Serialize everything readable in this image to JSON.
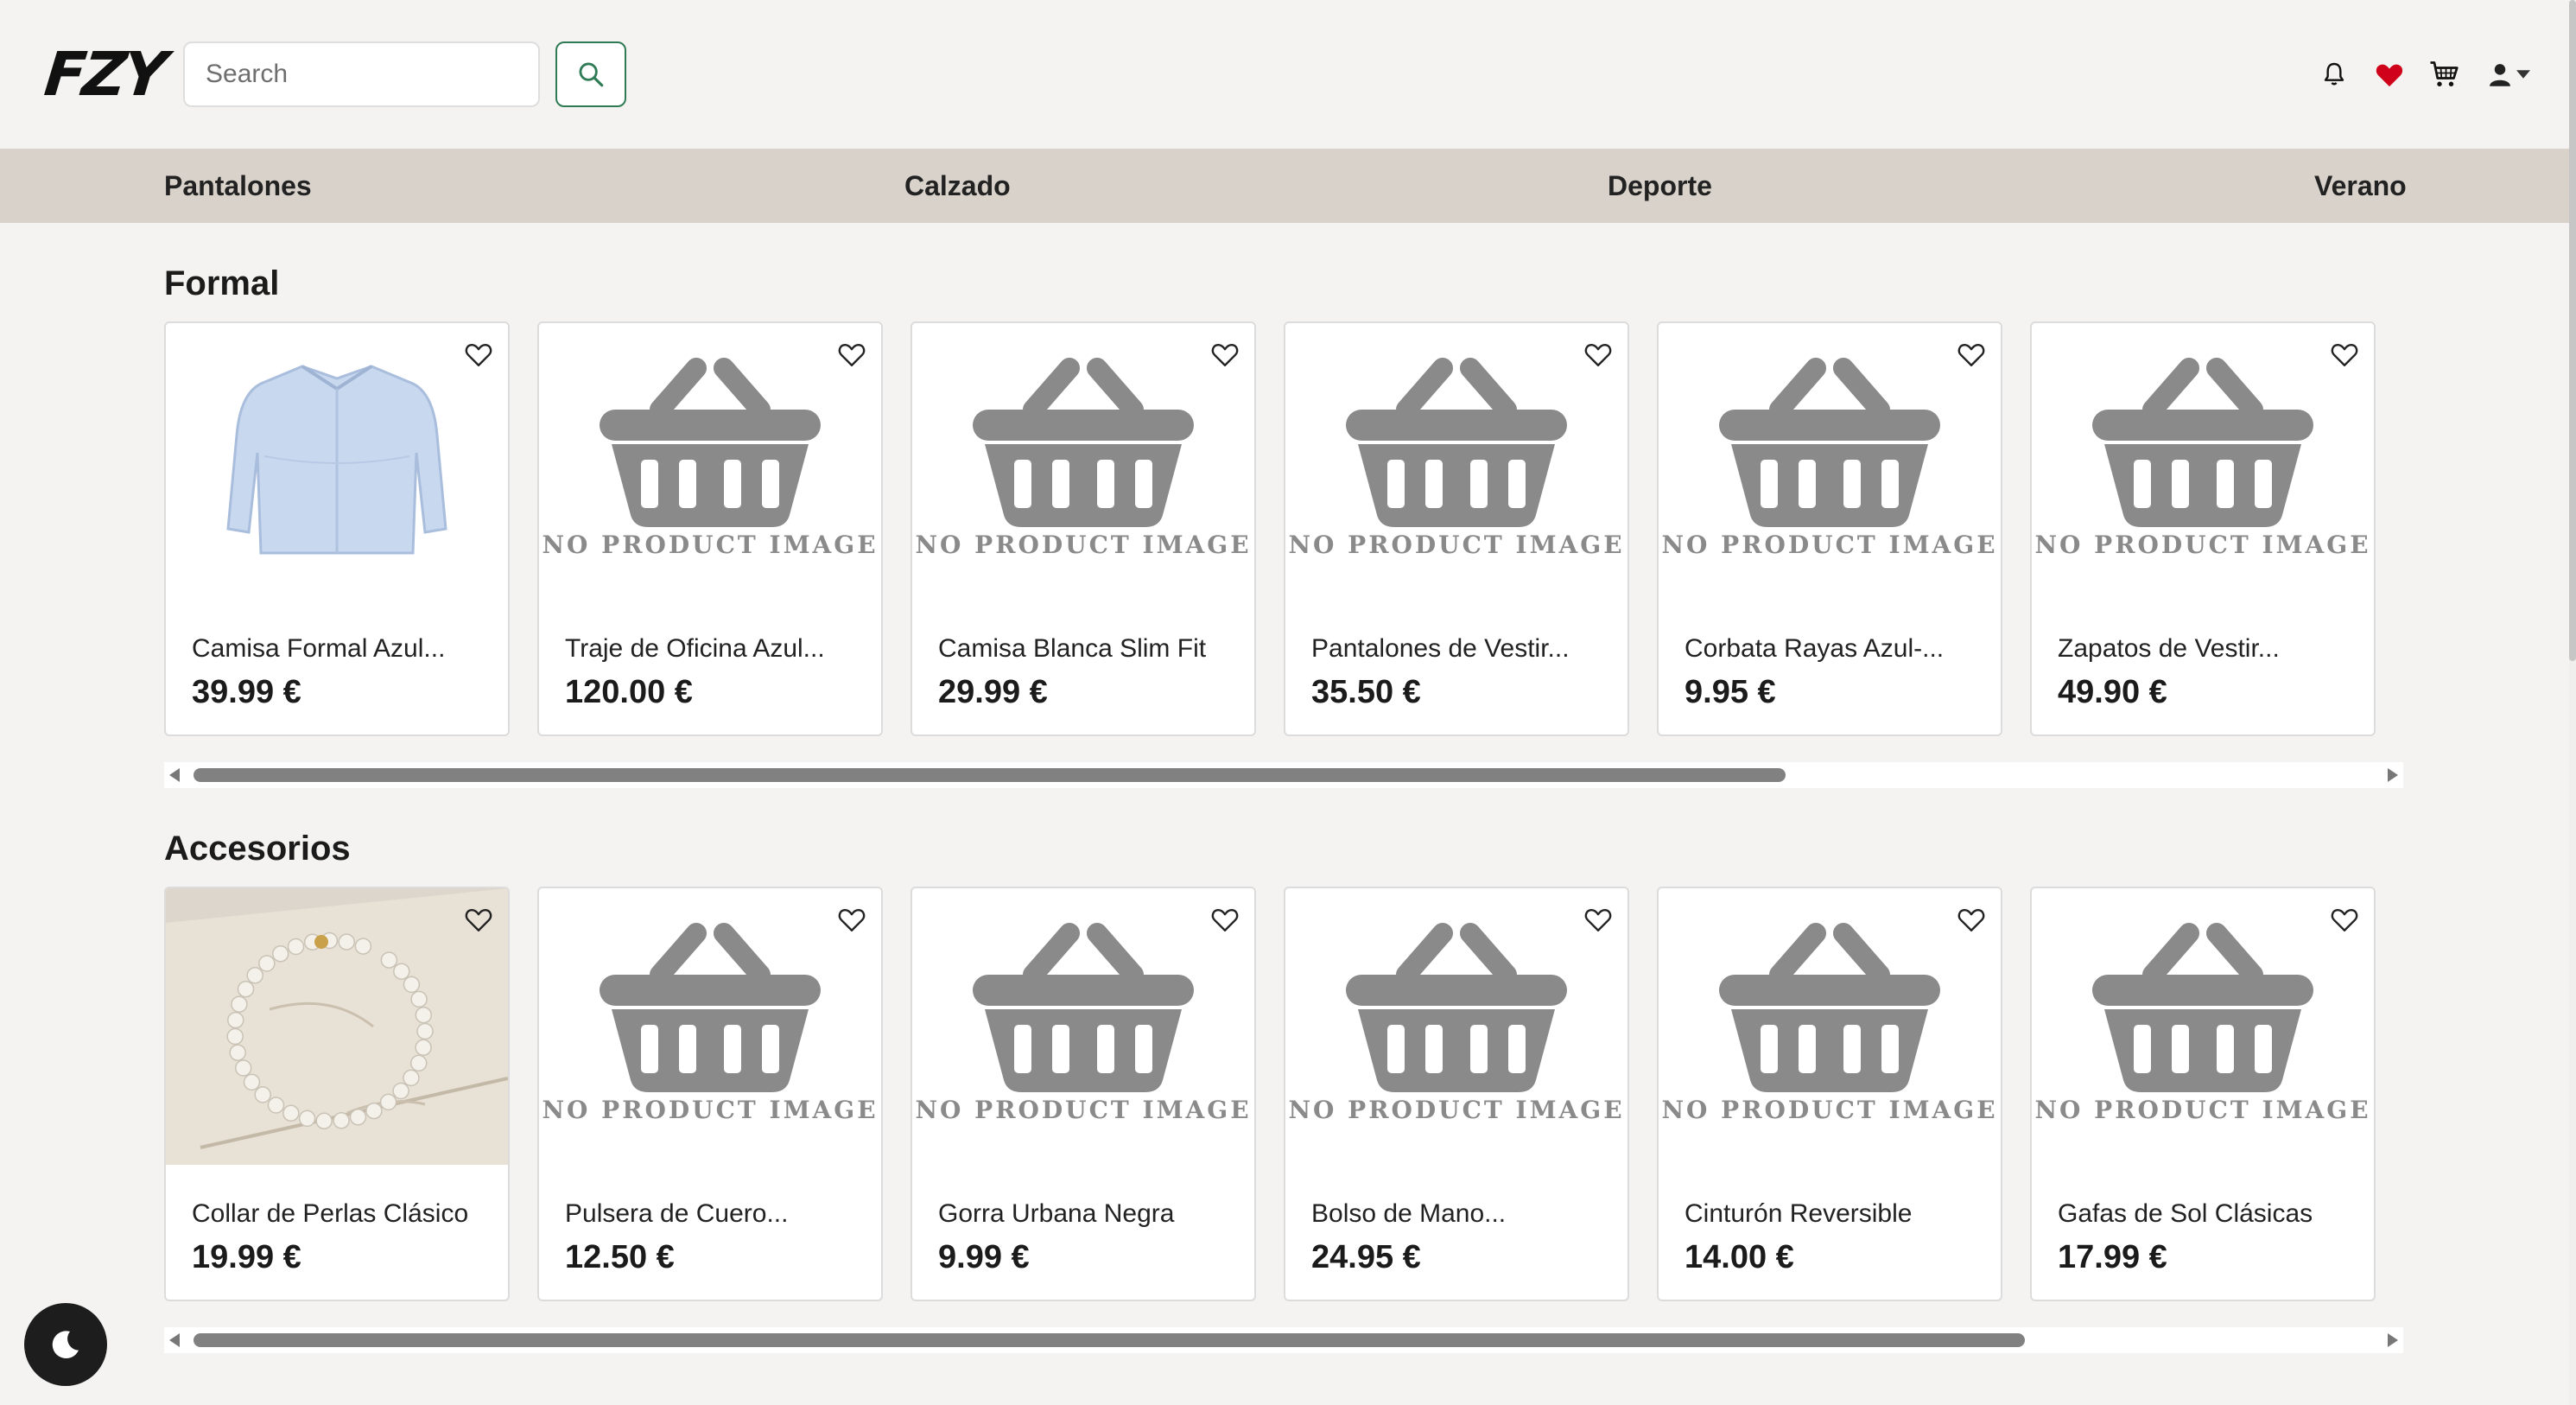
{
  "header": {
    "logo_text": "FZY",
    "search": {
      "placeholder": "Search",
      "value": ""
    },
    "icons": [
      "search-icon",
      "bell-icon",
      "heart-icon",
      "cart-icon",
      "user-icon",
      "caret-down-icon"
    ]
  },
  "categories": [
    "Pantalones",
    "Calzado",
    "Deporte",
    "Verano"
  ],
  "colors": {
    "accent_green": "#2e7b55",
    "favorite_red": "#d0021b",
    "category_bar": "#d8d2cb",
    "page_bg": "#f4f3f1"
  },
  "no_image_text": "NO PRODUCT IMAGE",
  "sections": [
    {
      "title": "Formal",
      "scroll_fraction": 0.73,
      "products": [
        {
          "name": "Camisa Formal Azul...",
          "price": "39.99 €",
          "image": "shirt"
        },
        {
          "name": "Traje de Oficina Azul...",
          "price": "120.00 €",
          "image": "none"
        },
        {
          "name": "Camisa Blanca Slim Fit",
          "price": "29.99 €",
          "image": "none"
        },
        {
          "name": "Pantalones de Vestir...",
          "price": "35.50 €",
          "image": "none"
        },
        {
          "name": "Corbata Rayas Azul-...",
          "price": "9.95 €",
          "image": "none"
        },
        {
          "name": "Zapatos de Vestir...",
          "price": "49.90 €",
          "image": "none"
        }
      ]
    },
    {
      "title": "Accesorios",
      "scroll_fraction": 0.84,
      "products": [
        {
          "name": "Collar de Perlas Clásico",
          "price": "19.99 €",
          "image": "pearls"
        },
        {
          "name": "Pulsera de Cuero...",
          "price": "12.50 €",
          "image": "none"
        },
        {
          "name": "Gorra Urbana Negra",
          "price": "9.99 €",
          "image": "none"
        },
        {
          "name": "Bolso de Mano...",
          "price": "24.95 €",
          "image": "none"
        },
        {
          "name": "Cinturón Reversible",
          "price": "14.00 €",
          "image": "none"
        },
        {
          "name": "Gafas de Sol Clásicas",
          "price": "17.99 €",
          "image": "none"
        }
      ]
    }
  ],
  "theme_toggle_icon": "moon-icon"
}
